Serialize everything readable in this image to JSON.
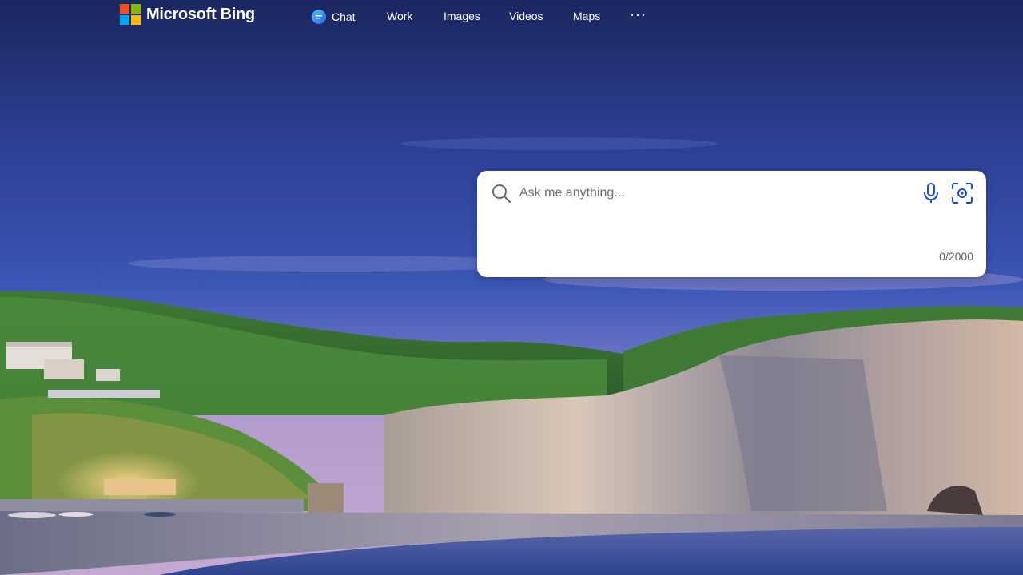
{
  "brand": {
    "name": "Microsoft Bing",
    "logo_colors": [
      "#f25022",
      "#7fba00",
      "#00a4ef",
      "#ffb900"
    ]
  },
  "nav": {
    "items": [
      {
        "label": "Chat",
        "icon": "chat-icon"
      },
      {
        "label": "Work"
      },
      {
        "label": "Images"
      },
      {
        "label": "Videos"
      },
      {
        "label": "Maps"
      }
    ],
    "more_label": "···"
  },
  "search": {
    "placeholder": "Ask me anything...",
    "value": "",
    "char_counter": "0/2000",
    "icons": [
      "search-icon",
      "microphone-icon",
      "visual-search-icon"
    ],
    "accent_color": "#174ae4"
  },
  "background": {
    "description_colors": {
      "sky_top": "#1e2a6e",
      "sky_mid": "#3c56b4",
      "horizon": "#b79ac9",
      "grass": "#4d8a3b",
      "cliff": "#cfc6bd",
      "sea": "#3b4f9a"
    }
  }
}
